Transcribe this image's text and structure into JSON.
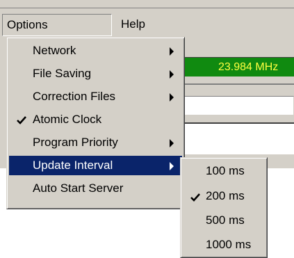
{
  "menubar": {
    "items": [
      {
        "label": "Options"
      },
      {
        "label": "Help"
      }
    ]
  },
  "frequency_display": "23.984 MHz",
  "options_menu": {
    "items": [
      {
        "label": "Network",
        "checked": false,
        "has_submenu": true
      },
      {
        "label": "File Saving",
        "checked": false,
        "has_submenu": true
      },
      {
        "label": "Correction Files",
        "checked": false,
        "has_submenu": true
      },
      {
        "label": "Atomic Clock",
        "checked": true,
        "has_submenu": false
      },
      {
        "label": "Program Priority",
        "checked": false,
        "has_submenu": true
      },
      {
        "label": "Update Interval",
        "checked": false,
        "has_submenu": true,
        "highlighted": true
      },
      {
        "label": "Auto Start Server",
        "checked": false,
        "has_submenu": false
      }
    ]
  },
  "update_interval_submenu": {
    "items": [
      {
        "label": "100 ms",
        "checked": false
      },
      {
        "label": "200 ms",
        "checked": true
      },
      {
        "label": "500 ms",
        "checked": false
      },
      {
        "label": "1000 ms",
        "checked": false
      }
    ]
  },
  "colors": {
    "menu_background": "#d4d0c8",
    "highlight": "#0a246a",
    "frequency_background": "#108a10",
    "frequency_text": "#ffff40"
  }
}
